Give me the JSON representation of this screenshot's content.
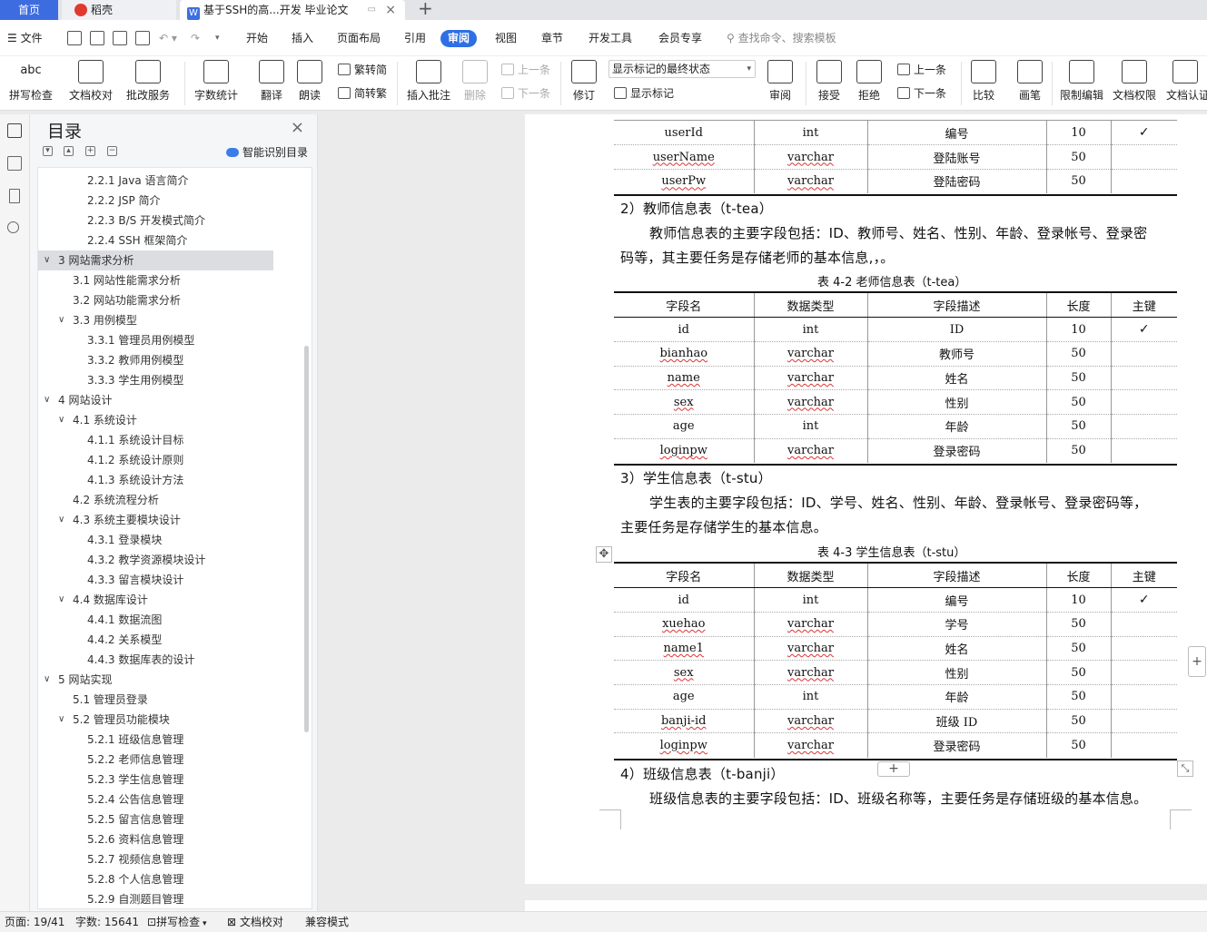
{
  "tabs": {
    "home": "首页",
    "daoke": "稻壳",
    "doc": "基于SSH的高...开发 毕业论文"
  },
  "menu": {
    "file": "文件",
    "items": [
      "开始",
      "插入",
      "页面布局",
      "引用",
      "审阅",
      "视图",
      "章节",
      "开发工具",
      "会员专享"
    ],
    "active": "审阅",
    "search": "查找命令、搜索模板"
  },
  "ribbon": {
    "spell": "拼写检查",
    "proofread": "文档校对",
    "correct": "批改服务",
    "wordcount": "字数统计",
    "translate": "翻译",
    "read": "朗读",
    "trad": "繁转简",
    "simp": "简转繁",
    "insert_comment": "插入批注",
    "delete": "删除",
    "prev": "上一条",
    "next": "下一条",
    "track": "修订",
    "markup_state": "显示标记的最终状态",
    "show_markup": "显示标记",
    "review": "审阅",
    "accept": "接受",
    "reject": "拒绝",
    "prev2": "上一条",
    "next2": "下一条",
    "compare": "比较",
    "pen": "画笔",
    "restrict": "限制编辑",
    "permission": "文档权限",
    "certify": "文档认证"
  },
  "toc": {
    "title": "目录",
    "smart": "智能识别目录",
    "items": [
      {
        "t": "2.2.1 Java 语言简介",
        "lvl": 3
      },
      {
        "t": "2.2.2 JSP 简介",
        "lvl": 3
      },
      {
        "t": "2.2.3 B/S 开发模式简介",
        "lvl": 3
      },
      {
        "t": "2.2.4 SSH 框架简介",
        "lvl": 3
      },
      {
        "t": "3  网站需求分析",
        "lvl": 1,
        "exp": true,
        "sel": true
      },
      {
        "t": "3.1  网站性能需求分析",
        "lvl": 2
      },
      {
        "t": "3.2  网站功能需求分析",
        "lvl": 2
      },
      {
        "t": "3.3  用例模型",
        "lvl": 2,
        "exp": true
      },
      {
        "t": "3.3.1  管理员用例模型",
        "lvl": 3
      },
      {
        "t": "3.3.2  教师用例模型",
        "lvl": 3
      },
      {
        "t": "3.3.3  学生用例模型",
        "lvl": 3
      },
      {
        "t": "4  网站设计",
        "lvl": 1,
        "exp": true
      },
      {
        "t": "4.1  系统设计",
        "lvl": 2,
        "exp": true
      },
      {
        "t": "4.1.1  系统设计目标",
        "lvl": 3
      },
      {
        "t": "4.1.2  系统设计原则",
        "lvl": 3
      },
      {
        "t": "4.1.3  系统设计方法",
        "lvl": 3
      },
      {
        "t": "4.2  系统流程分析",
        "lvl": 2
      },
      {
        "t": "4.3  系统主要模块设计",
        "lvl": 2,
        "exp": true
      },
      {
        "t": "4.3.1  登录模块",
        "lvl": 3
      },
      {
        "t": "4.3.2  教学资源模块设计",
        "lvl": 3
      },
      {
        "t": "4.3.3  留言模块设计",
        "lvl": 3
      },
      {
        "t": "4.4  数据库设计",
        "lvl": 2,
        "exp": true
      },
      {
        "t": "4.4.1  数据流图",
        "lvl": 3
      },
      {
        "t": "4.4.2  关系模型",
        "lvl": 3
      },
      {
        "t": "4.4.3  数据库表的设计",
        "lvl": 3
      },
      {
        "t": "5  网站实现",
        "lvl": 1,
        "exp": true
      },
      {
        "t": "5.1  管理员登录",
        "lvl": 2
      },
      {
        "t": "5.2  管理员功能模块",
        "lvl": 2,
        "exp": true
      },
      {
        "t": "5.2.1  班级信息管理",
        "lvl": 3
      },
      {
        "t": "5.2.2  老师信息管理",
        "lvl": 3
      },
      {
        "t": "5.2.3  学生信息管理",
        "lvl": 3
      },
      {
        "t": "5.2.4  公告信息管理",
        "lvl": 3
      },
      {
        "t": "5.2.5  留言信息管理",
        "lvl": 3
      },
      {
        "t": "5.2.6  资料信息管理",
        "lvl": 3
      },
      {
        "t": "5.2.7  视频信息管理",
        "lvl": 3
      },
      {
        "t": "5.2.8 个人信息管理",
        "lvl": 3
      },
      {
        "t": "5.2.9  自测题目管理",
        "lvl": 3
      }
    ]
  },
  "doc": {
    "table1": {
      "rows": [
        [
          "userId",
          "int",
          "编号",
          "10",
          "✓"
        ],
        [
          "userName",
          "varchar",
          "登陆账号",
          "50",
          ""
        ],
        [
          "userPw",
          "varchar",
          "登陆密码",
          "50",
          ""
        ]
      ]
    },
    "sec2_title": "2）教师信息表（t-tea）",
    "sec2_p1": "教师信息表的主要字段包括：ID、教师号、姓名、性别、年龄、登录帐号、登录密",
    "sec2_p2": "码等，其主要任务是存储老师的基本信息,，。",
    "cap2": "表 4-2  老师信息表（t-tea）",
    "header": [
      "字段名",
      "数据类型",
      "字段描述",
      "长度",
      "主键"
    ],
    "table2": {
      "rows": [
        [
          "id",
          "int",
          "ID",
          "10",
          "✓"
        ],
        [
          "bianhao",
          "varchar",
          "教师号",
          "50",
          ""
        ],
        [
          "name",
          "varchar",
          "姓名",
          "50",
          ""
        ],
        [
          "sex",
          "varchar",
          "性别",
          "50",
          ""
        ],
        [
          "age",
          "int",
          "年龄",
          "50",
          ""
        ],
        [
          "loginpw",
          "varchar",
          "登录密码",
          "50",
          ""
        ]
      ]
    },
    "sec3_title": "3）学生信息表（t-stu）",
    "sec3_p1": "学生表的主要字段包括：ID、学号、姓名、性别、年龄、登录帐号、登录密码等，",
    "sec3_p2": "主要任务是存储学生的基本信息。",
    "cap3": "表 4-3  学生信息表（t-stu）",
    "table3": {
      "rows": [
        [
          "id",
          "int",
          "编号",
          "10",
          "✓"
        ],
        [
          "xuehao",
          "varchar",
          "学号",
          "50",
          ""
        ],
        [
          "name1",
          "varchar",
          "姓名",
          "50",
          ""
        ],
        [
          "sex",
          "varchar",
          "性别",
          "50",
          ""
        ],
        [
          "age",
          "int",
          "年龄",
          "50",
          ""
        ],
        [
          "banji-id",
          "varchar",
          "班级 ID",
          "50",
          ""
        ],
        [
          "loginpw",
          "varchar",
          "登录密码",
          "50",
          ""
        ]
      ]
    },
    "sec4_title": "4）班级信息表（t-banji）",
    "sec4_p1": "班级信息表的主要字段包括：ID、班级名称等，主要任务是存储班级的基本信息。"
  },
  "status": {
    "page": "页面: 19/41",
    "words": "字数: 15641",
    "spell": "拼写检查",
    "proof": "文档校对",
    "compat": "兼容模式"
  }
}
